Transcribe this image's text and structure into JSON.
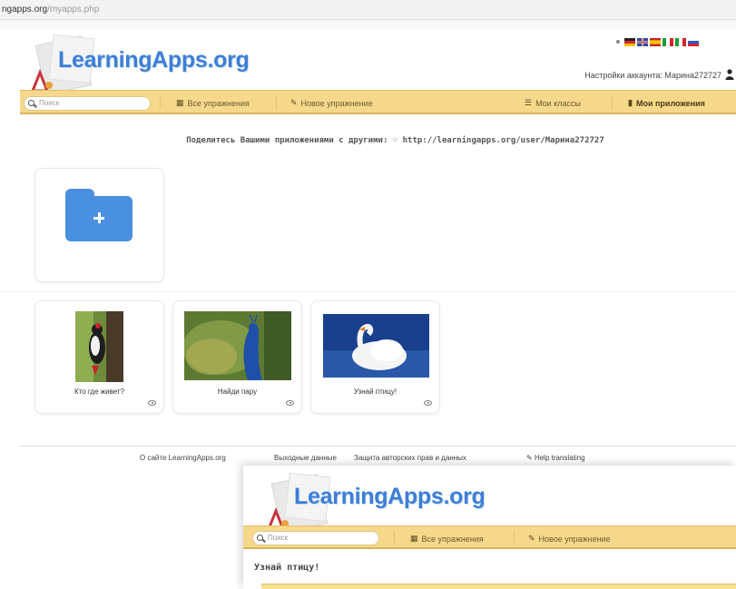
{
  "browser": {
    "url_host": "ngapps.org",
    "url_path": "/myapps.php"
  },
  "header": {
    "logo_text": "LearningApps.org",
    "account_text": "Настройки аккаунта: Марина272727",
    "account_icon": "user-icon",
    "flags": [
      {
        "name": "german-flag",
        "colors": [
          "#222222",
          "#d9262c",
          "#f2c300"
        ]
      },
      {
        "name": "uk-flag",
        "colors": [
          "#2b4a9b",
          "#d93a3a",
          "#ffffff"
        ]
      },
      {
        "name": "spanish-flag",
        "colors": [
          "#c8202a",
          "#f3c300",
          "#c8202a"
        ]
      },
      {
        "name": "italian-flag",
        "colors": [
          "#1a9b3a",
          "#ffffff",
          "#d6262c"
        ]
      },
      {
        "name": "russian-flag",
        "colors": [
          "#ffffff",
          "#2a5ac9",
          "#d6262c"
        ]
      }
    ]
  },
  "navbar": {
    "search_placeholder": "Поиск",
    "all_exercises": "Все упражнения",
    "new_exercise": "Новое упражнение",
    "my_classes": "Мои классы",
    "my_apps": "Мои приложения"
  },
  "share": {
    "text": "Поделитесь Вашими приложениями с другими: ☞ http://learningapps.org/user/Марина272727"
  },
  "folder_card": {
    "icon": "add-folder-icon",
    "color": "#4a8fe0"
  },
  "apps": [
    {
      "title": "Кто где живет?",
      "image": "woodpecker"
    },
    {
      "title": "Найди пару",
      "image": "peacock"
    },
    {
      "title": "Узнай птицу!",
      "image": "swan"
    }
  ],
  "footer": {
    "about": "О сайте LearningApps.org",
    "imprint": "Выходные данные",
    "privacy": "Защита авторских прав и данных",
    "help": "Help translating"
  },
  "overlay": {
    "logo_text": "LearningApps.org",
    "search_placeholder": "Поиск",
    "all_exercises": "Все упражнения",
    "new_exercise": "Новое упражнение",
    "app_title": "Узнай птицу!"
  },
  "colors": {
    "navbar": "#f5d88a",
    "brand_blue": "#3d7fd6"
  }
}
